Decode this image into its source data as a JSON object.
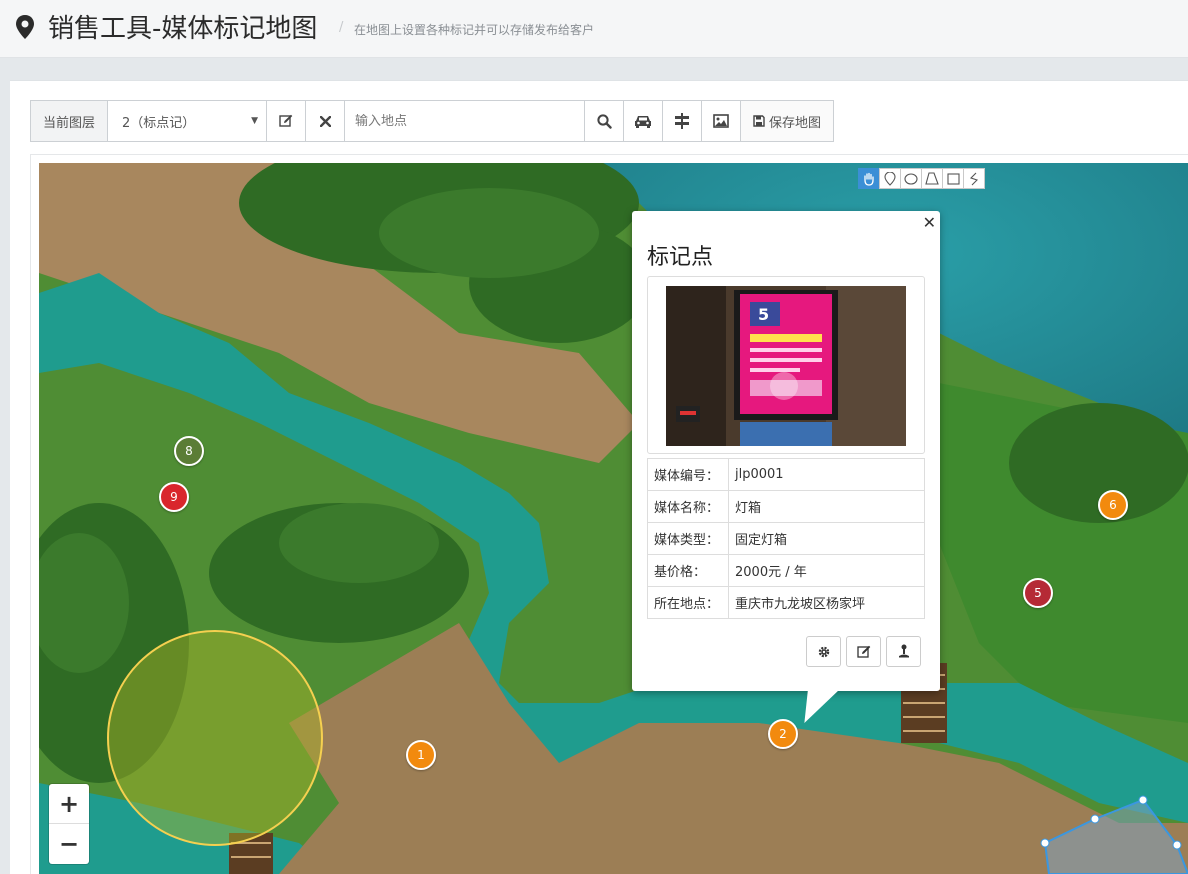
{
  "header": {
    "title": "销售工具-媒体标记地图",
    "separator": "/",
    "subtitle": "在地图上设置各种标记并可以存储发布给客户"
  },
  "toolbar": {
    "layer_label": "当前图层",
    "layer_selected": "2（标点记）",
    "search_placeholder": "输入地点",
    "save_label": "保存地图"
  },
  "map": {
    "zoom_in": "+",
    "zoom_out": "−",
    "draw_tools": [
      "hand-icon",
      "marker-icon",
      "circle-icon",
      "polygon-icon",
      "rectangle-icon",
      "polyline-icon"
    ],
    "markers": [
      {
        "label": "1",
        "color": "#f28a0e"
      },
      {
        "label": "2",
        "color": "#f28a0e"
      },
      {
        "label": "5",
        "color": "#b52a35"
      },
      {
        "label": "6",
        "color": "#f28a0e"
      },
      {
        "label": "8",
        "color": "#5b7d36"
      },
      {
        "label": "9",
        "color": "#d9262c"
      }
    ]
  },
  "popup": {
    "close": "✕",
    "title": "标记点",
    "rows": [
      {
        "key": "媒体编号：",
        "value": "jlp0001"
      },
      {
        "key": "媒体名称：",
        "value": "灯箱"
      },
      {
        "key": "媒体类型：",
        "value": "固定灯箱"
      },
      {
        "key": "基价格：",
        "value": "2000元 / 年"
      },
      {
        "key": "所在地点：",
        "value": "重庆市九龙坡区杨家坪"
      }
    ],
    "photo_sign": "5"
  },
  "colors": {
    "accent_blue": "#3b8fd6",
    "marker_orange": "#f28a0e",
    "marker_red": "#d9262c",
    "marker_darkred": "#b52a35",
    "marker_green": "#5b7d36",
    "circle_stroke": "#f5d050"
  }
}
